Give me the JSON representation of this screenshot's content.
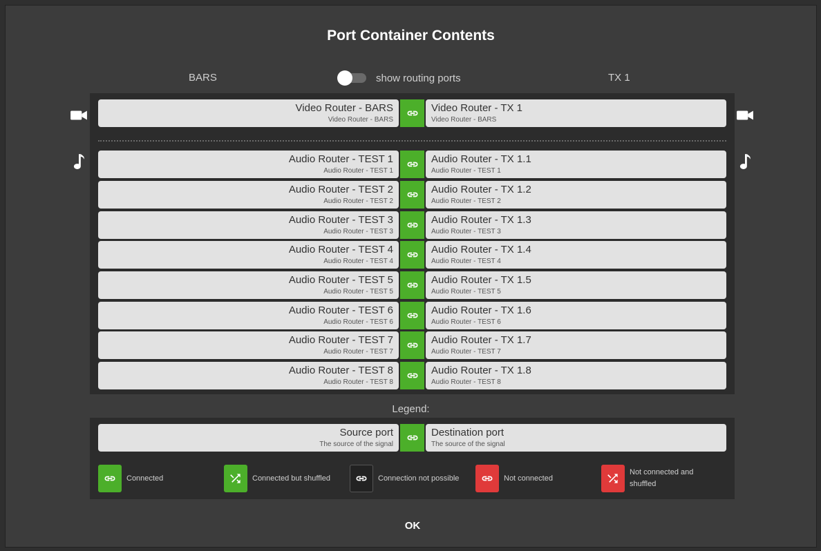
{
  "dialog": {
    "title": "Port Container Contents",
    "source_header": "BARS",
    "destination_header": "TX 1",
    "toggle_label": "show routing ports",
    "ok_label": "OK"
  },
  "video_rows": [
    {
      "source_main": "Video Router - BARS",
      "source_sub": "Video Router - BARS",
      "dest_main": "Video Router - TX 1",
      "dest_sub": "Video Router - BARS"
    }
  ],
  "audio_rows": [
    {
      "source_main": "Audio Router - TEST 1",
      "source_sub": "Audio Router - TEST 1",
      "dest_main": "Audio Router - TX 1.1",
      "dest_sub": "Audio Router - TEST 1"
    },
    {
      "source_main": "Audio Router - TEST 2",
      "source_sub": "Audio Router - TEST 2",
      "dest_main": "Audio Router - TX 1.2",
      "dest_sub": "Audio Router - TEST 2"
    },
    {
      "source_main": "Audio Router - TEST 3",
      "source_sub": "Audio Router - TEST 3",
      "dest_main": "Audio Router - TX 1.3",
      "dest_sub": "Audio Router - TEST 3"
    },
    {
      "source_main": "Audio Router - TEST 4",
      "source_sub": "Audio Router - TEST 4",
      "dest_main": "Audio Router - TX 1.4",
      "dest_sub": "Audio Router - TEST 4"
    },
    {
      "source_main": "Audio Router - TEST 5",
      "source_sub": "Audio Router - TEST 5",
      "dest_main": "Audio Router - TX 1.5",
      "dest_sub": "Audio Router - TEST 5"
    },
    {
      "source_main": "Audio Router - TEST 6",
      "source_sub": "Audio Router - TEST 6",
      "dest_main": "Audio Router - TX 1.6",
      "dest_sub": "Audio Router - TEST 6"
    },
    {
      "source_main": "Audio Router - TEST 7",
      "source_sub": "Audio Router - TEST 7",
      "dest_main": "Audio Router - TX 1.7",
      "dest_sub": "Audio Router - TEST 7"
    },
    {
      "source_main": "Audio Router - TEST 8",
      "source_sub": "Audio Router - TEST 8",
      "dest_main": "Audio Router - TX 1.8",
      "dest_sub": "Audio Router - TEST 8"
    }
  ],
  "legend": {
    "title": "Legend:",
    "sample": {
      "source_main": "Source port",
      "source_sub": "The source of the signal",
      "dest_main": "Destination port",
      "dest_sub": "The source of the signal"
    },
    "items": [
      {
        "label": "Connected",
        "icon": "link-icon",
        "color": "#4caf2a"
      },
      {
        "label": "Connected but shuffled",
        "icon": "shuffle-icon",
        "color": "#4caf2a"
      },
      {
        "label": "Connection not possible",
        "icon": "link-icon",
        "color": "#222222"
      },
      {
        "label": "Not connected",
        "icon": "link-icon",
        "color": "#e03a3a"
      },
      {
        "label": "Not connected and shuffled",
        "icon": "shuffle-icon",
        "color": "#e03a3a"
      }
    ]
  },
  "icons": {
    "video": "video-camera-icon",
    "audio": "music-note-icon"
  },
  "colors": {
    "connected": "#4caf2a",
    "not_connected": "#e03a3a",
    "background": "#3c3c3c",
    "panel": "#2c2c2c"
  }
}
